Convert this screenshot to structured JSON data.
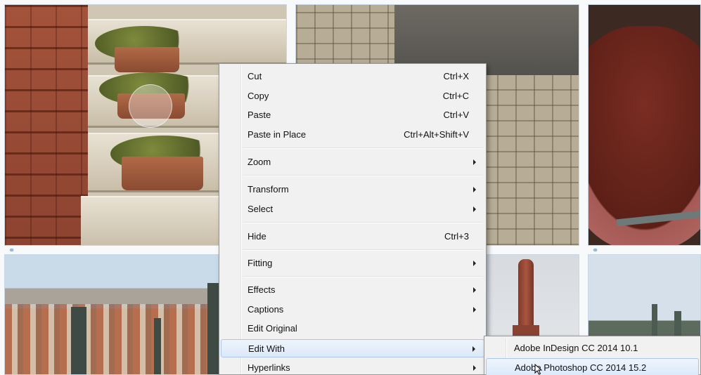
{
  "context_menu": {
    "items": [
      {
        "label": "Cut",
        "shortcut": "Ctrl+X"
      },
      {
        "label": "Copy",
        "shortcut": "Ctrl+C"
      },
      {
        "label": "Paste",
        "shortcut": "Ctrl+V"
      },
      {
        "label": "Paste in Place",
        "shortcut": "Ctrl+Alt+Shift+V"
      },
      {
        "label": "Zoom"
      },
      {
        "label": "Transform"
      },
      {
        "label": "Select"
      },
      {
        "label": "Hide",
        "shortcut": "Ctrl+3"
      },
      {
        "label": "Fitting"
      },
      {
        "label": "Effects"
      },
      {
        "label": "Captions"
      },
      {
        "label": "Edit Original"
      },
      {
        "label": "Edit With"
      },
      {
        "label": "Hyperlinks"
      }
    ]
  },
  "submenu": {
    "items": [
      {
        "label": "Adobe InDesign CC 2014 10.1"
      },
      {
        "label": "Adobe Photoshop CC 2014 15.2"
      }
    ]
  },
  "colors": {
    "menu_background": "#f1f1f1",
    "menu_border": "#979797",
    "highlight": "#dce9f9",
    "highlight_border": "#a9c6ec",
    "frame_border": "#c9d6e3",
    "link_icon": "#6aa0d8"
  },
  "icons": {
    "submenu_arrow": "triangle-right",
    "link": "chain-link",
    "pointer": "arrow-cursor"
  }
}
